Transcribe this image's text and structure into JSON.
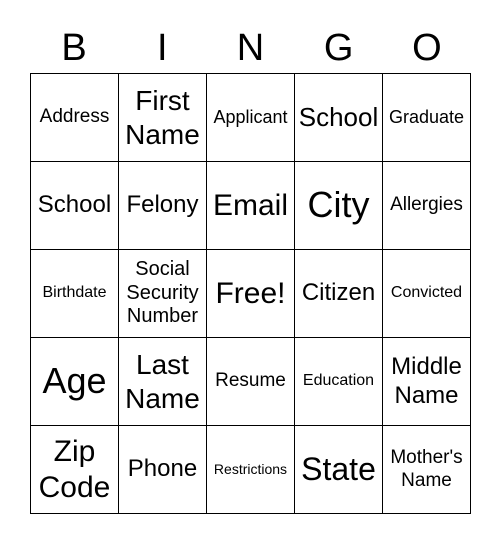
{
  "header": [
    "B",
    "I",
    "N",
    "G",
    "O"
  ],
  "cells": [
    "Address",
    "First Name",
    "Applicant",
    "School",
    "Graduate",
    "School",
    "Felony",
    "Email",
    "City",
    "Allergies",
    "Birthdate",
    "Social Security Number",
    "Free!",
    "Citizen",
    "Convicted",
    "Age",
    "Last Name",
    "Resume",
    "Education",
    "Middle Name",
    "Zip Code",
    "Phone",
    "Restrictions",
    "State",
    "Mother's Name"
  ]
}
